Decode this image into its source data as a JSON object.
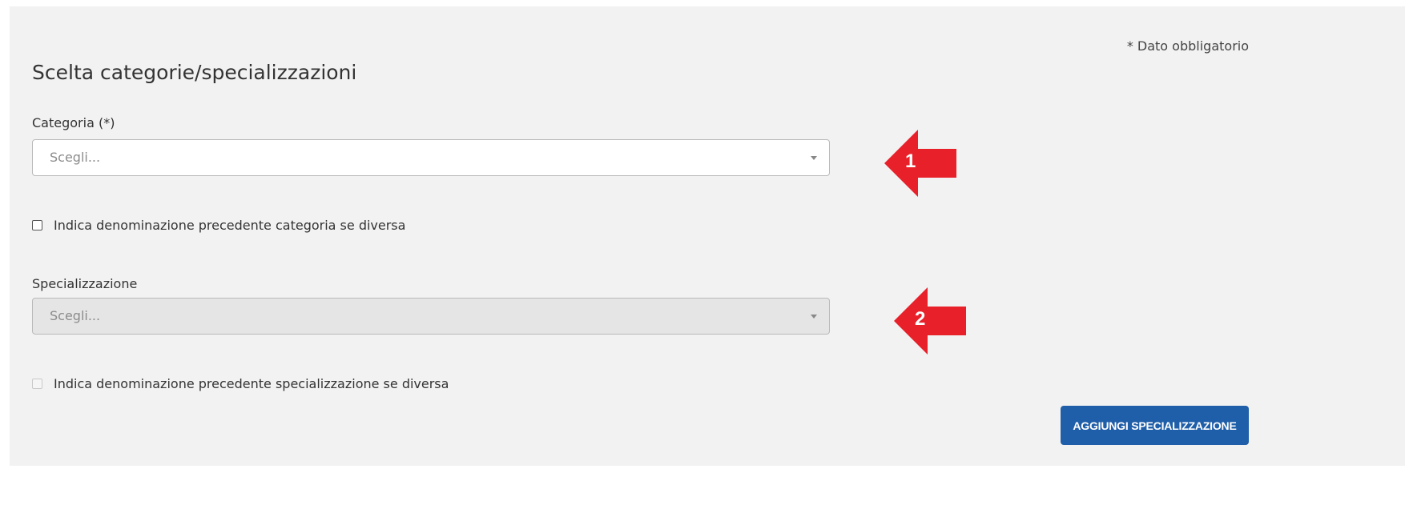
{
  "required_note": "* Dato obbligatorio",
  "section_title": "Scelta categorie/specializzazioni",
  "categoria": {
    "label": "Categoria (*)",
    "placeholder": "Scegli...",
    "enabled": true
  },
  "categoria_checkbox": {
    "label": "Indica denominazione precedente categoria se diversa",
    "checked": false,
    "enabled": true
  },
  "specializzazione": {
    "label": "Specializzazione",
    "placeholder": "Scegli...",
    "enabled": false
  },
  "specializzazione_checkbox": {
    "label": "Indica denominazione precedente specializzazione se diversa",
    "checked": false,
    "enabled": false
  },
  "add_button": {
    "label": "AGGIUNGI SPECIALIZZAZIONE"
  },
  "annotations": {
    "arrow_1": "1",
    "arrow_2": "2"
  },
  "colors": {
    "panel_bg": "#f2f2f2",
    "button_bg": "#1f5ea8",
    "annotation_red": "#e8202a"
  }
}
